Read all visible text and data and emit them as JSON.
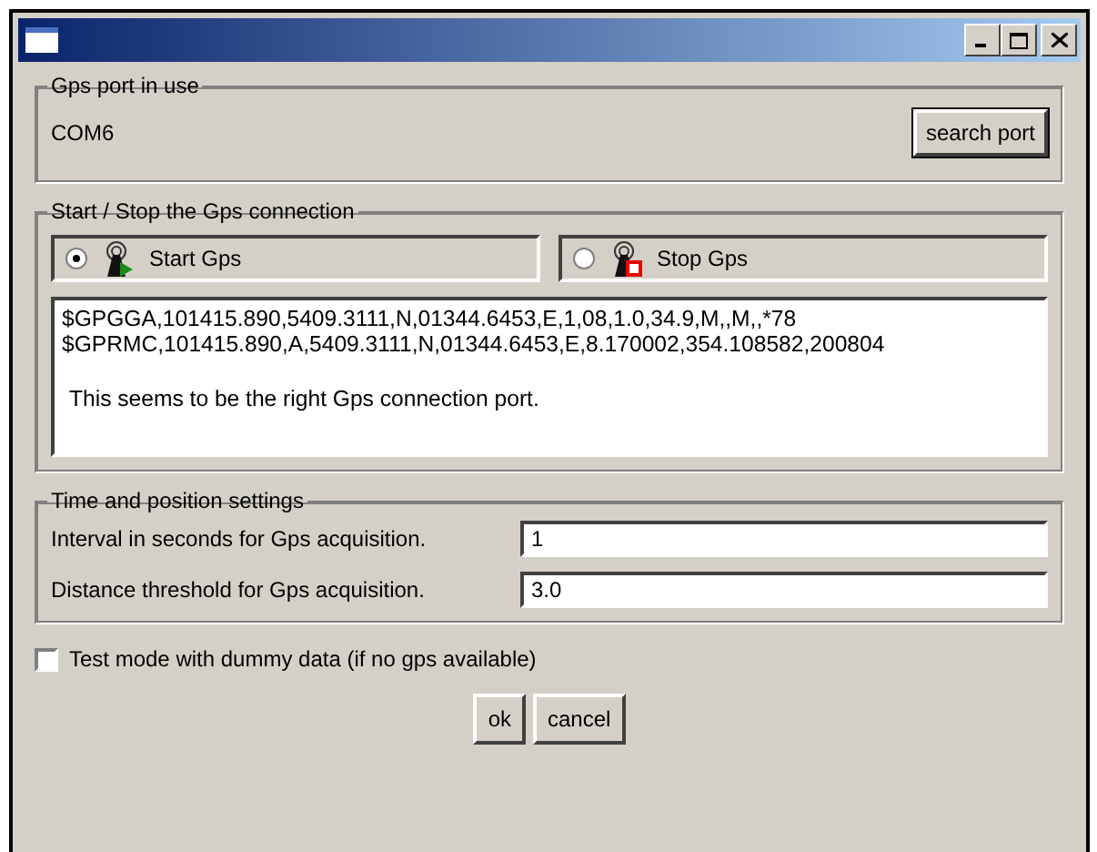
{
  "port_group": {
    "title": "Gps port in use",
    "port": "COM6",
    "button": "search port"
  },
  "connection_group": {
    "title": "Start / Stop the Gps connection",
    "options": [
      {
        "label": "Start Gps",
        "kind": "start",
        "selected": true
      },
      {
        "label": "Stop Gps",
        "kind": "stop",
        "selected": false
      }
    ],
    "log": [
      "$GPGGA,101415.890,5409.3111,N,01344.6453,E,1,08,1.0,34.9,M,,M,,*78",
      "$GPRMC,101415.890,A,5409.3111,N,01344.6453,E,8.170002,354.108582,200804"
    ],
    "message": "This seems to be the right Gps connection port."
  },
  "settings_group": {
    "title": "Time and position settings",
    "fields": [
      {
        "label": "Interval in seconds for Gps acquisition.",
        "value": "1"
      },
      {
        "label": "Distance threshold for Gps acquisition.",
        "value": "3.0"
      }
    ]
  },
  "test_mode": {
    "label": "Test mode with dummy data (if no gps available)",
    "checked": false
  },
  "buttons": [
    "ok",
    "cancel"
  ]
}
